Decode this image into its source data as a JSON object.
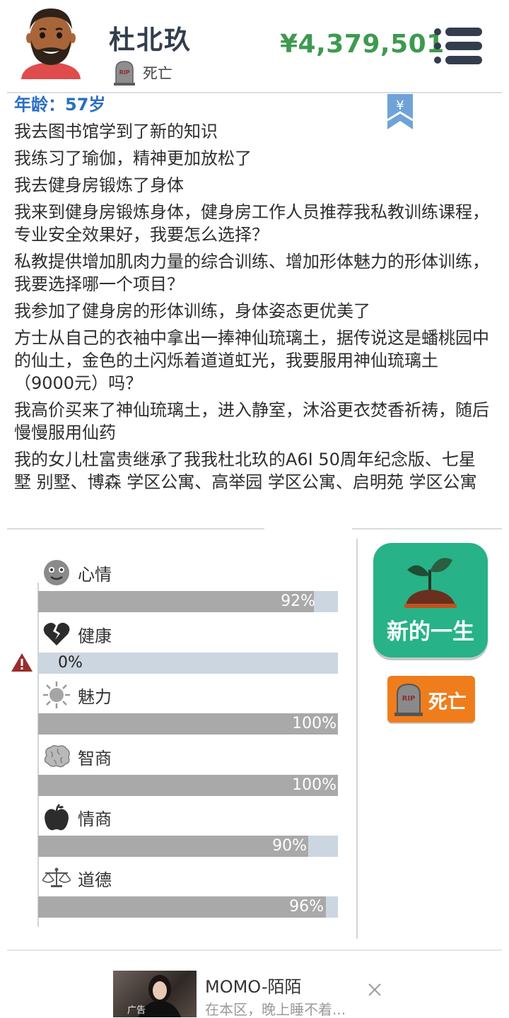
{
  "header": {
    "name": "杜北玖",
    "status": "死亡",
    "money": "¥4,379,501",
    "tomb_text": "RIP"
  },
  "bookmark": {
    "symbol": "¥"
  },
  "log": {
    "age": "年龄：57岁",
    "entries": [
      "我去图书馆学到了新的知识",
      "我练习了瑜伽，精神更加放松了",
      "我去健身房锻炼了身体",
      "我来到健身房锻炼身体，健身房工作人员推荐我私教训练课程，专业安全效果好，我要怎么选择？",
      "私教提供增加肌肉力量的综合训练、增加形体魅力的形体训练，我要选择哪一个项目？",
      "我参加了健身房的形体训练，身体姿态更优美了",
      "方士从自己的衣袖中拿出一捧神仙琉璃土，据传说这是蟠桃园中的仙土，金色的土闪烁着道道虹光，我要服用神仙琉璃土（9000元）吗？",
      "我高价买来了神仙琉璃土，进入静室，沐浴更衣焚香祈祷，随后慢慢服用仙药",
      "我的女儿杜富贵继承了我我杜北玖的A6I 50周年纪念版、七星墅 别墅、博森 学区公寓、高举园 学区公寓、启明苑 学区公寓"
    ]
  },
  "stats": [
    {
      "label": "心情",
      "value": 92,
      "display": "92%",
      "icon": "smiley-icon"
    },
    {
      "label": "健康",
      "value": 0,
      "display": "0%",
      "icon": "broken-heart-icon"
    },
    {
      "label": "魅力",
      "value": 100,
      "display": "100%",
      "icon": "sun-icon"
    },
    {
      "label": "智商",
      "value": 100,
      "display": "100%",
      "icon": "brain-icon"
    },
    {
      "label": "情商",
      "value": 90,
      "display": "90%",
      "icon": "apple-icon"
    },
    {
      "label": "道德",
      "value": 96,
      "display": "96%",
      "icon": "scales-icon"
    }
  ],
  "buttons": {
    "new_life": "新的一生",
    "death": "死亡"
  },
  "ad": {
    "title": "MOMO-陌陌",
    "subtitle": "在本区，晚上睡不着...",
    "tag": "广告"
  },
  "colors": {
    "money": "#3e9a4f",
    "age": "#2a6fc1",
    "new_life": "#27b287",
    "death": "#f07d1c",
    "bar_track": "#ccd6e0",
    "bar_fill": "#a9a9a9",
    "bookmark": "#6fa3d8"
  }
}
